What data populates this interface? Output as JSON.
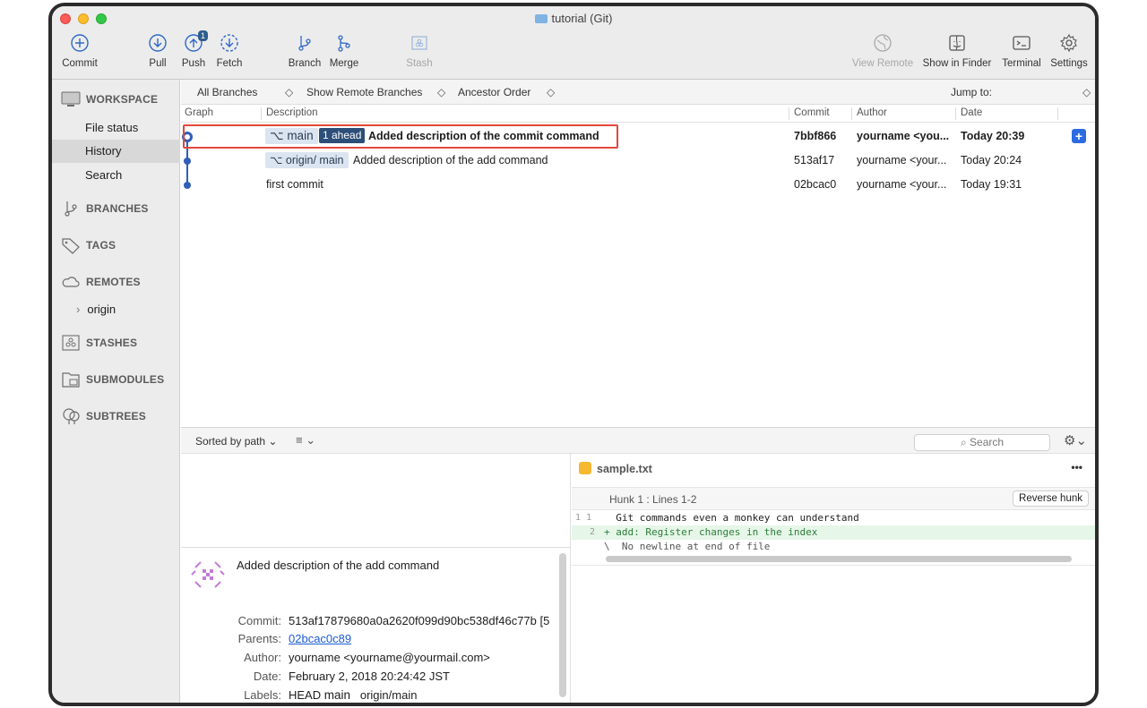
{
  "window": {
    "title": "tutorial (Git)"
  },
  "toolbar": {
    "commit": "Commit",
    "pull": "Pull",
    "push": "Push",
    "push_badge": "1",
    "fetch": "Fetch",
    "branch": "Branch",
    "merge": "Merge",
    "stash": "Stash",
    "view_remote": "View Remote",
    "show_in_finder": "Show in Finder",
    "terminal": "Terminal",
    "settings": "Settings"
  },
  "sidebar": {
    "workspace": "WORKSPACE",
    "file_status": "File status",
    "history": "History",
    "search": "Search",
    "branches": "BRANCHES",
    "tags": "TAGS",
    "remotes": "REMOTES",
    "origin": "origin",
    "stashes": "STASHES",
    "submodules": "SUBMODULES",
    "subtrees": "SUBTREES"
  },
  "filters": {
    "all_branches": "All Branches",
    "show_remote": "Show Remote Branches",
    "ancestor_order": "Ancestor Order",
    "jump_to": "Jump to:"
  },
  "columns": {
    "graph": "Graph",
    "description": "Description",
    "commit": "Commit",
    "author": "Author",
    "date": "Date"
  },
  "commits": [
    {
      "branch": "main",
      "ahead": "1 ahead",
      "message": "Added description of the commit command",
      "hash": "7bbf866",
      "author": "yourname <you...",
      "date": "Today 20:39"
    },
    {
      "branch": "origin/ main",
      "message": "Added description of the add command",
      "hash": "513af17",
      "author": "yourname <your...",
      "date": "Today 20:24"
    },
    {
      "message": "first commit",
      "hash": "02bcac0",
      "author": "yourname <your...",
      "date": "Today 19:31"
    }
  ],
  "lower_toolbar": {
    "sort": "Sorted by path",
    "search_placeholder": "Search"
  },
  "details": {
    "message": "Added description of the add command",
    "commit_label": "Commit:",
    "commit": "513af17879680a0a2620f099d90bc538df46c77b [5",
    "parents_label": "Parents:",
    "parents": "02bcac0c89",
    "author_label": "Author:",
    "author": "yourname <yourname@yourmail.com>",
    "date_label": "Date:",
    "date": "February 2, 2018 20:24:42 JST",
    "labels_label": "Labels:",
    "labels_head": "HEAD",
    "labels_main": "main",
    "labels_origin": "origin/main"
  },
  "diff": {
    "file": "sample.txt",
    "more": "•••",
    "hunk": "Hunk 1 : Lines 1-2",
    "reverse": "Reverse hunk",
    "lines": [
      {
        "old": "1",
        "new": "1",
        "text": "  Git commands even a monkey can understand"
      },
      {
        "old": "",
        "new": "2",
        "text": "+ add: Register changes in the index"
      },
      {
        "old": "",
        "new": "",
        "text": "\\  No newline at end of file"
      }
    ]
  }
}
